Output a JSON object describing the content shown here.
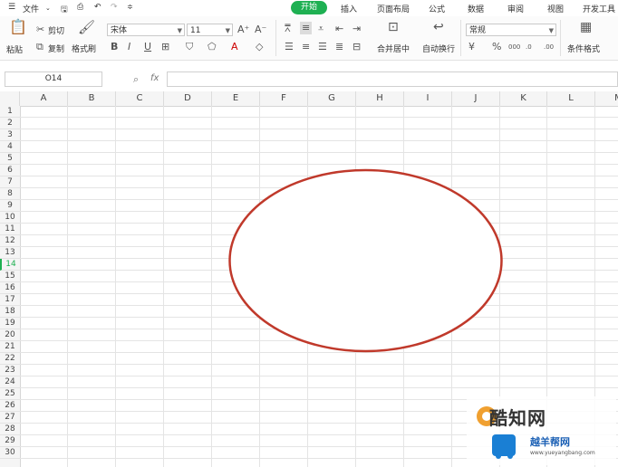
{
  "menu": {
    "file": "文件",
    "tabs": [
      "开始",
      "插入",
      "页面布局",
      "公式",
      "数据",
      "审阅",
      "视图",
      "开发工具"
    ]
  },
  "ribbon": {
    "paste": "粘贴",
    "cut": "剪切",
    "copy": "复制",
    "format_painter": "格式刷",
    "font_name": "宋体",
    "font_size": "11",
    "merge_center": "合并居中",
    "wrap_text": "自动换行",
    "number_format": "常规",
    "conditional_format": "条件格式"
  },
  "formula_bar": {
    "name_box": "O14",
    "fx": "fx",
    "value": ""
  },
  "grid": {
    "columns": [
      "A",
      "B",
      "C",
      "D",
      "E",
      "F",
      "G",
      "H",
      "I",
      "J",
      "K",
      "L",
      "M"
    ],
    "rows": [
      "1",
      "2",
      "3",
      "4",
      "5",
      "6",
      "7",
      "8",
      "9",
      "10",
      "11",
      "12",
      "13",
      "14",
      "15",
      "16",
      "17",
      "18",
      "19",
      "20",
      "21",
      "22",
      "23",
      "24",
      "25",
      "26",
      "27",
      "28",
      "29",
      "30"
    ],
    "selected_row": "14"
  },
  "shape": {
    "type": "ellipse",
    "stroke": "#c0392b",
    "fill": "#ffffff"
  },
  "watermark": {
    "brand": "酷知网",
    "brand2": "越羊帮网",
    "url": "www.yueyangbang.com"
  },
  "colors": {
    "accent": "#1eb052"
  }
}
